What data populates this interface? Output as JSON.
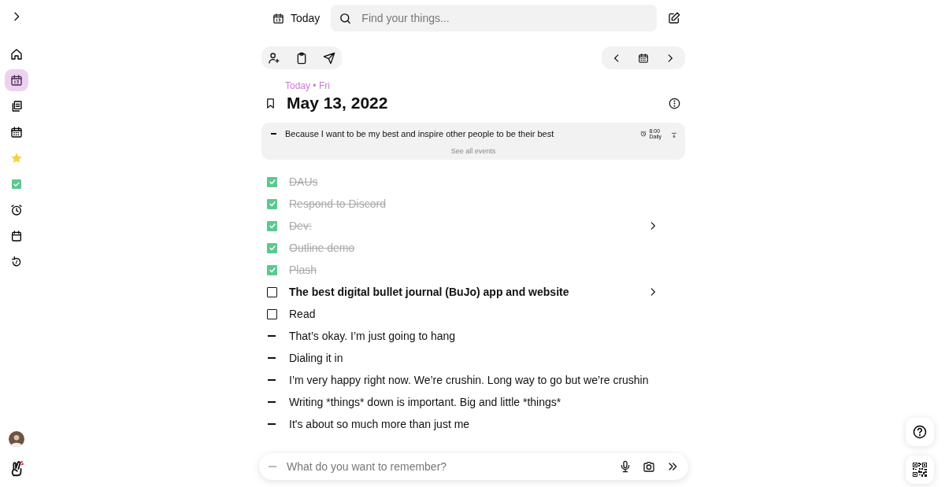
{
  "sidebar": {
    "items": [
      {
        "selected": false
      },
      {
        "selected": true
      },
      {
        "selected": false
      },
      {
        "selected": false
      },
      {
        "selected": false
      },
      {
        "selected": false
      },
      {
        "selected": false
      },
      {
        "selected": false
      },
      {
        "selected": false
      }
    ]
  },
  "top_bar": {
    "today_label": "Today",
    "search": {
      "placeholder": "Find your things..."
    }
  },
  "day": {
    "label": "Today • Fri",
    "title": "May 13, 2022",
    "event": {
      "text": "Because I want to be my best and inspire other people to be their best",
      "time": "8:00",
      "repeat": "Daily",
      "see_all": "See all events"
    },
    "entries": [
      {
        "kind": "task",
        "text": "DAUs",
        "checked": true,
        "has_children": false,
        "bold": false
      },
      {
        "kind": "task",
        "text": "Respond to Discord",
        "checked": true,
        "has_children": false,
        "bold": false
      },
      {
        "kind": "task",
        "text": "Dev:",
        "checked": true,
        "has_children": true,
        "bold": false
      },
      {
        "kind": "task",
        "text": "Outline demo",
        "checked": true,
        "has_children": false,
        "bold": false
      },
      {
        "kind": "task",
        "text": "Plash",
        "checked": true,
        "has_children": false,
        "bold": false
      },
      {
        "kind": "task",
        "text": "The best digital bullet journal (BuJo) app and website",
        "checked": false,
        "has_children": true,
        "bold": true
      },
      {
        "kind": "task",
        "text": "Read",
        "checked": false,
        "has_children": false,
        "bold": false
      },
      {
        "kind": "note",
        "text": "That’s okay. I’m just going to hang"
      },
      {
        "kind": "note",
        "text": "Dialing it in"
      },
      {
        "kind": "note",
        "text": "I’m very happy right now. We’re crushin. Long way to go but we’re crushin"
      },
      {
        "kind": "note",
        "text": "Writing *things* down is important. Big and little *things*"
      },
      {
        "kind": "note",
        "text": "It's about so much more than just me"
      }
    ]
  },
  "composer": {
    "placeholder": "What do you want to remember?"
  }
}
